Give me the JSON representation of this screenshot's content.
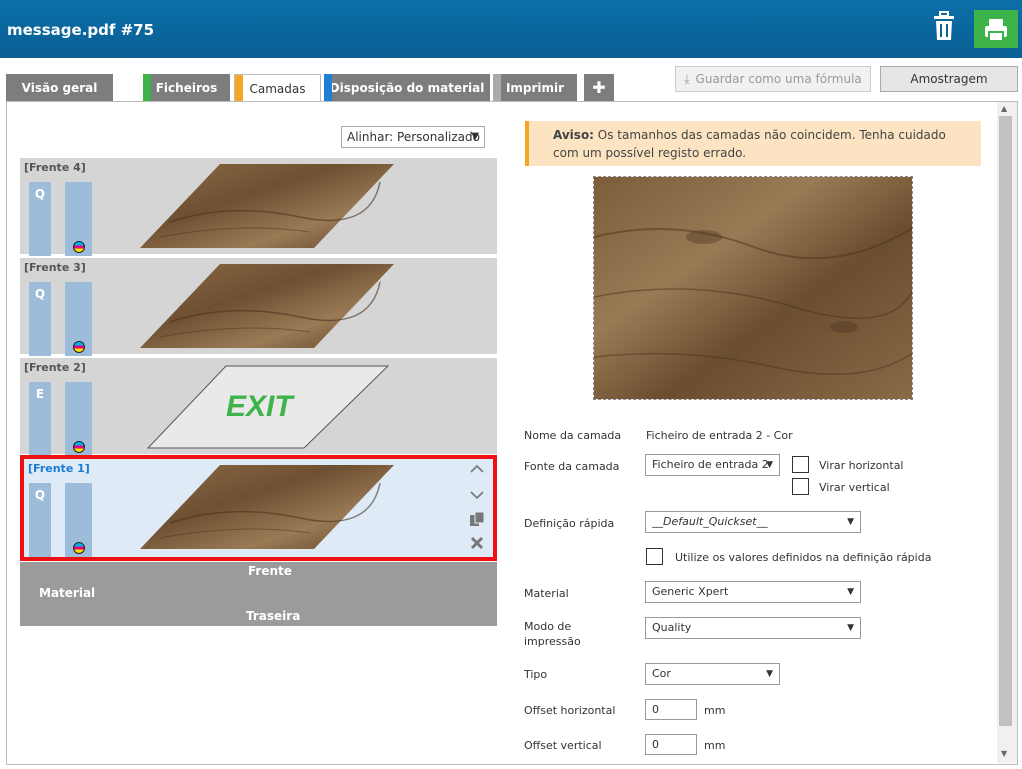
{
  "header": {
    "title": "message.pdf #75",
    "trash_icon": "trash-icon",
    "print_icon": "print-icon"
  },
  "tabs": [
    {
      "label": "Visão geral",
      "color": ""
    },
    {
      "label": "Ficheiros",
      "color": "#3db34a"
    },
    {
      "label": "Camadas",
      "color": "#f5a623"
    },
    {
      "label": "Disposição do material",
      "color": "#1e7fd3"
    },
    {
      "label": "Imprimir",
      "color": "#aaaaaa"
    },
    {
      "label": "✚",
      "color": ""
    }
  ],
  "toolbar": {
    "save_formula": "Guardar como uma fórmula",
    "sample": "Amostragem"
  },
  "align": {
    "value": "Alinhar: Personalizado"
  },
  "layers": [
    {
      "label": "[Frente 4]",
      "mode": "Q"
    },
    {
      "label": "[Frente 3]",
      "mode": "Q"
    },
    {
      "label": "[Frente 2]",
      "mode": "E",
      "content": "EXIT"
    },
    {
      "label": "[Frente 1]",
      "mode": "Q"
    }
  ],
  "material_bar": {
    "front": "Frente",
    "material": "Material",
    "back": "Traseira"
  },
  "warning": {
    "bold": "Aviso:",
    "text": " Os tamanhos das camadas não coincidem. Tenha cuidado com um possível registo errado."
  },
  "form": {
    "layer_name_label": "Nome da camada",
    "layer_name_value": "Ficheiro de entrada 2 - Cor",
    "layer_source_label": "Fonte da camada",
    "layer_source_value": "Ficheiro de entrada 2",
    "flip_h": "Virar horizontal",
    "flip_v": "Virar vertical",
    "quickset_label": "Definição rápida",
    "quickset_value": "__Default_Quickset__",
    "use_quickset": "Utilize os valores definidos na definição rápida",
    "material_label": "Material",
    "material_value": "Generic Xpert",
    "print_mode_label_1": "Modo de",
    "print_mode_label_2": "impressão",
    "print_mode_value": "Quality",
    "type_label": "Tipo",
    "type_value": "Cor",
    "offset_h_label": "Offset horizontal",
    "offset_h_value": "0",
    "offset_v_label": "Offset vertical",
    "offset_v_value": "0",
    "unit": "mm"
  }
}
